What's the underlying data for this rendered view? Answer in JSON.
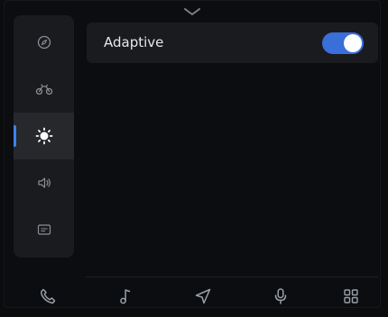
{
  "colors": {
    "accent": "#3a6fd9",
    "active_indicator": "#3b82f6",
    "panel": "#1a1b1e",
    "background": "#0c0d10"
  },
  "sidebar": {
    "items": [
      {
        "icon": "compass-icon",
        "active": false
      },
      {
        "icon": "vehicle-icon",
        "active": false
      },
      {
        "icon": "brightness-icon",
        "active": true
      },
      {
        "icon": "volume-icon",
        "active": false
      },
      {
        "icon": "display-card-icon",
        "active": false
      }
    ]
  },
  "main": {
    "settings": [
      {
        "label": "Adaptive",
        "toggle_on": true
      }
    ]
  },
  "dock": {
    "items": [
      {
        "icon": "phone-icon"
      },
      {
        "icon": "music-note-icon"
      },
      {
        "icon": "navigation-arrow-icon"
      },
      {
        "icon": "microphone-icon"
      },
      {
        "icon": "app-grid-icon"
      }
    ]
  }
}
